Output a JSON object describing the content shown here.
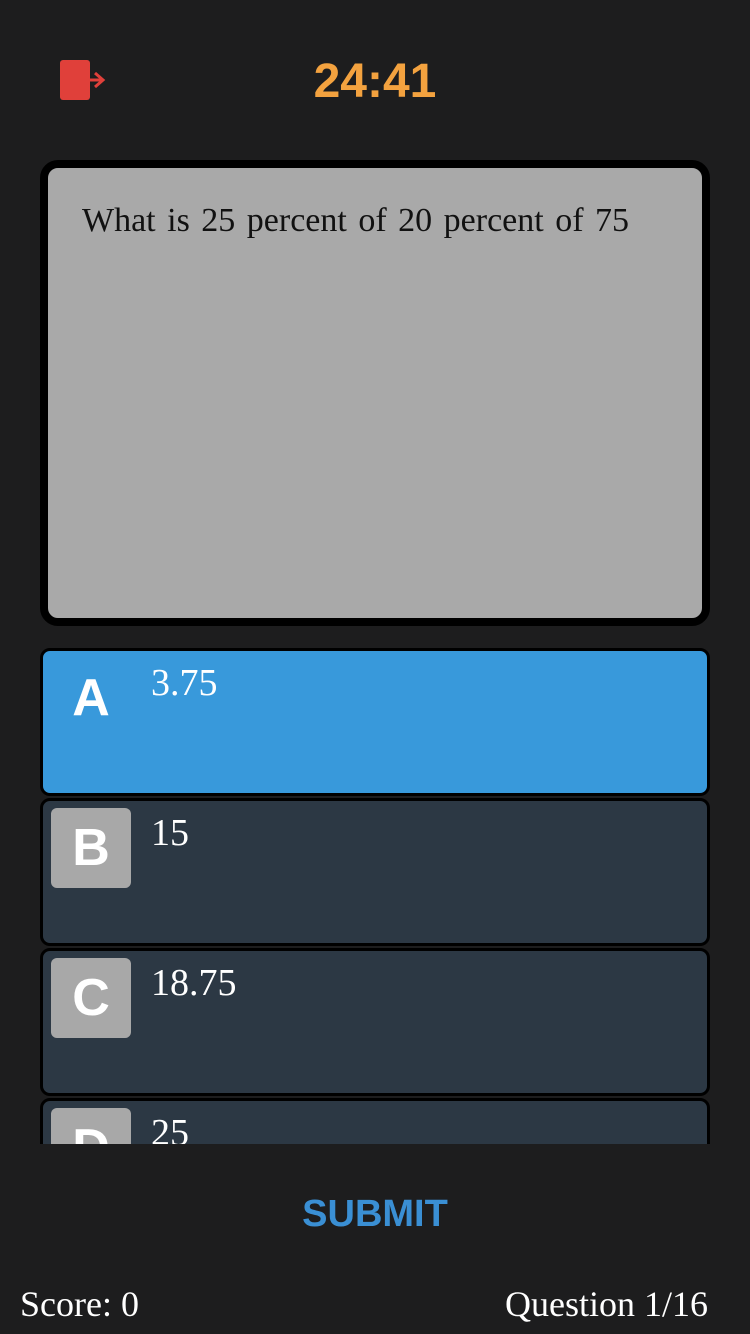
{
  "header": {
    "exit_icon": "exit-icon",
    "timer": "24:41"
  },
  "question": {
    "text": "What is 25 percent of 20 percent of 75"
  },
  "answers": [
    {
      "letter": "A",
      "value": "3.75",
      "selected": true
    },
    {
      "letter": "B",
      "value": "15",
      "selected": false
    },
    {
      "letter": "C",
      "value": "18.75",
      "selected": false
    },
    {
      "letter": "D",
      "value": "25",
      "selected": false
    }
  ],
  "submit_label": "SUBMIT",
  "footer": {
    "score": "Score: 0",
    "progress": "Question 1/16"
  },
  "colors": {
    "background": "#1d1d1e",
    "timer": "#f3a23f",
    "exit_icon": "#e0403a",
    "question_card": "#a9a9a9",
    "answer_default": "#2c3844",
    "answer_selected": "#3899db",
    "submit": "#3a8fd4"
  }
}
